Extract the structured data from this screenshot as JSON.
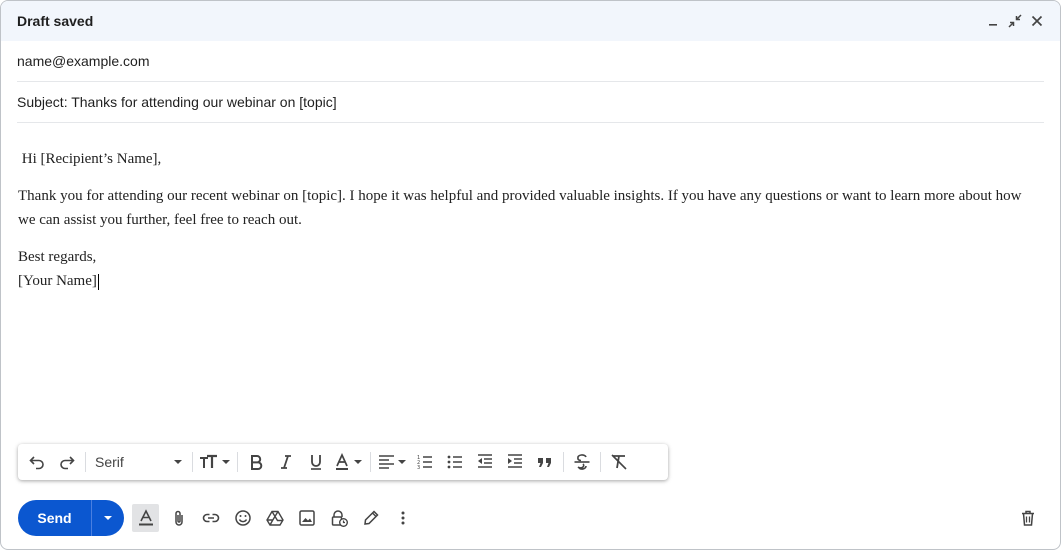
{
  "window": {
    "title": "Draft saved"
  },
  "compose": {
    "to": "name@example.com",
    "subject": "Subject: Thanks for attending our webinar on [topic]",
    "body": {
      "greeting": "Hi [Recipient’s Name],",
      "paragraph": "Thank you for attending our recent webinar on [topic]. I hope it was helpful and provided valuable insights. If you have any questions or want to learn more about how we can assist you further, feel free to reach out.",
      "closing": "Best regards,",
      "signature": "[Your Name]"
    }
  },
  "formatting": {
    "font": "Serif"
  },
  "actions": {
    "send_label": "Send"
  },
  "colors": {
    "accent": "#0b57d0",
    "titlebar_bg": "#f2f6fc"
  }
}
